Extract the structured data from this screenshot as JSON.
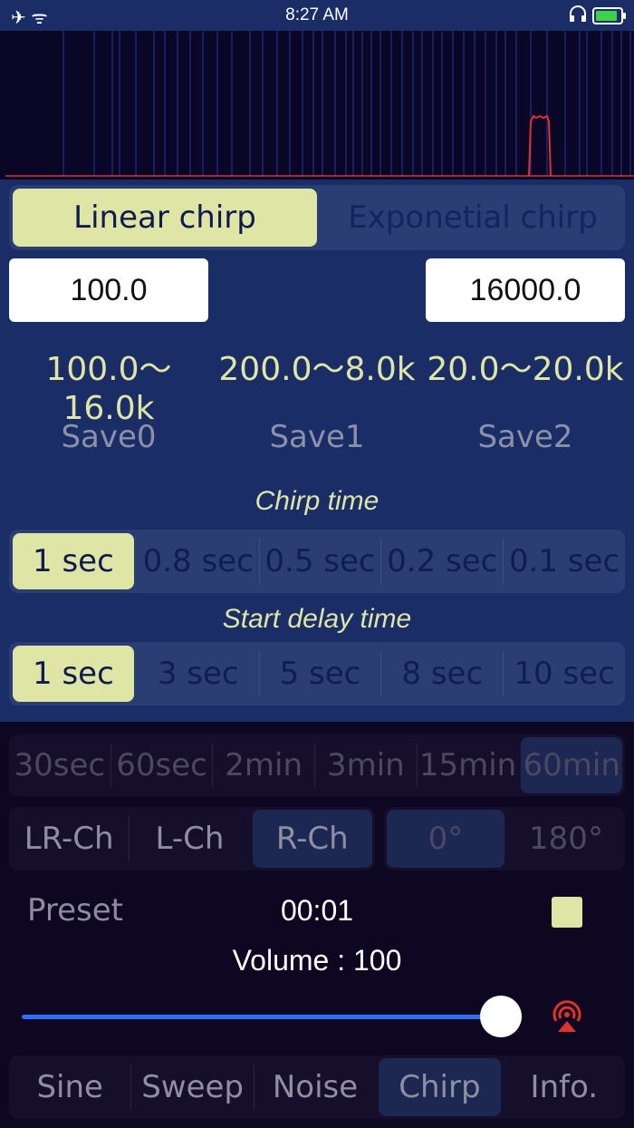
{
  "status_bar": {
    "time": "8:27 AM",
    "left_icons": "✈ ᯤ",
    "headphones_icon": "🎧",
    "battery_level": 0.9
  },
  "colors": {
    "panel": "#1b2d66",
    "selected": "#dfe5a5",
    "spectrum_line": "#e0312a",
    "slider": "#2e6ff5"
  },
  "chirp_mode": {
    "options": [
      "Linear chirp",
      "Exponetial chirp"
    ],
    "selected": "Linear chirp"
  },
  "freq_start": "100.0",
  "freq_end": "16000.0",
  "ranges": [
    "100.0〜16.0k",
    "200.0〜8.0k",
    "20.0〜20.0k"
  ],
  "saves": [
    "Save0",
    "Save1",
    "Save2"
  ],
  "chirp_time": {
    "title": "Chirp time",
    "options": [
      "1 sec",
      "0.8 sec",
      "0.5 sec",
      "0.2 sec",
      "0.1 sec"
    ],
    "selected": "1 sec"
  },
  "start_delay": {
    "title": "Start delay time",
    "options": [
      "1 sec",
      "3 sec",
      "5 sec",
      "8 sec",
      "10 sec"
    ],
    "selected": "1 sec"
  },
  "duration": {
    "options": [
      "30sec",
      "60sec",
      "2min",
      "3min",
      "15min",
      "60min"
    ],
    "selected": "60min"
  },
  "channel": {
    "options": [
      "LR-Ch",
      "L-Ch",
      "R-Ch"
    ],
    "selected": "R-Ch"
  },
  "phase": {
    "options": [
      "0°",
      "180°"
    ],
    "selected": "0°"
  },
  "preset_label": "Preset",
  "timer": "00:01",
  "volume_label": "Volume : 100",
  "volume_value": 100,
  "bottom_tabs": {
    "options": [
      "Sine",
      "Sweep",
      "Noise",
      "Chirp",
      "Info."
    ],
    "selected": "Chirp"
  }
}
